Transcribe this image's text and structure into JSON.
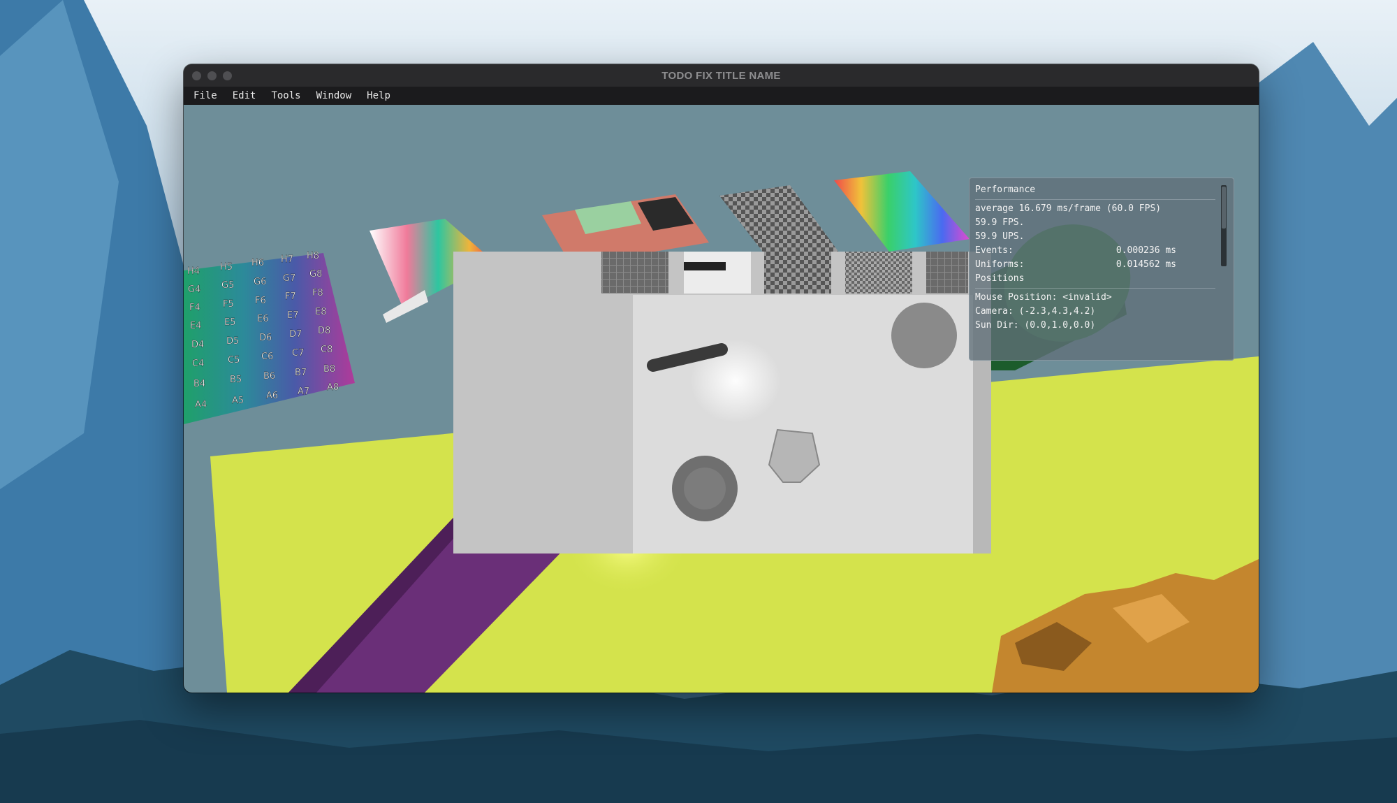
{
  "window": {
    "title": "TODO FIX TITLE NAME"
  },
  "menu": [
    "File",
    "Edit",
    "Tools",
    "Window",
    "Help"
  ],
  "chart_labels": {
    "rows": [
      [
        "H4",
        "H5",
        "H6",
        "H7",
        "H8"
      ],
      [
        "G4",
        "G5",
        "G6",
        "G7",
        "G8"
      ],
      [
        "F4",
        "F5",
        "F6",
        "F7",
        "F8"
      ],
      [
        "E4",
        "E5",
        "E6",
        "E7",
        "E8"
      ],
      [
        "D4",
        "D5",
        "D6",
        "D7",
        "D8"
      ],
      [
        "C4",
        "C5",
        "C6",
        "C7",
        "C8"
      ],
      [
        "B4",
        "B5",
        "B6",
        "B7",
        "B8"
      ],
      [
        "A4",
        "A5",
        "A6",
        "A7",
        "A8"
      ]
    ]
  },
  "perf": {
    "header": "Performance",
    "average": "average 16.679 ms/frame (60.0 FPS)",
    "fps": "59.9 FPS.",
    "ups": "59.9 UPS.",
    "events_label": "Events:",
    "events_value": "0.000236 ms",
    "uniforms_label": "Uniforms:",
    "uniforms_value": "0.014562 ms",
    "positions": "Positions",
    "mouse": "Mouse Position: <invalid>",
    "camera": "Camera: (-2.3,4.3,4.2)",
    "sun": "Sun Dir: (0.0,1.0,0.0)"
  },
  "colors": {
    "floor": "#d4e34c",
    "sky": "#6e8e99",
    "cone": "#1c5c2c",
    "purple": "#6a2f78",
    "rock": "#c4862e"
  }
}
